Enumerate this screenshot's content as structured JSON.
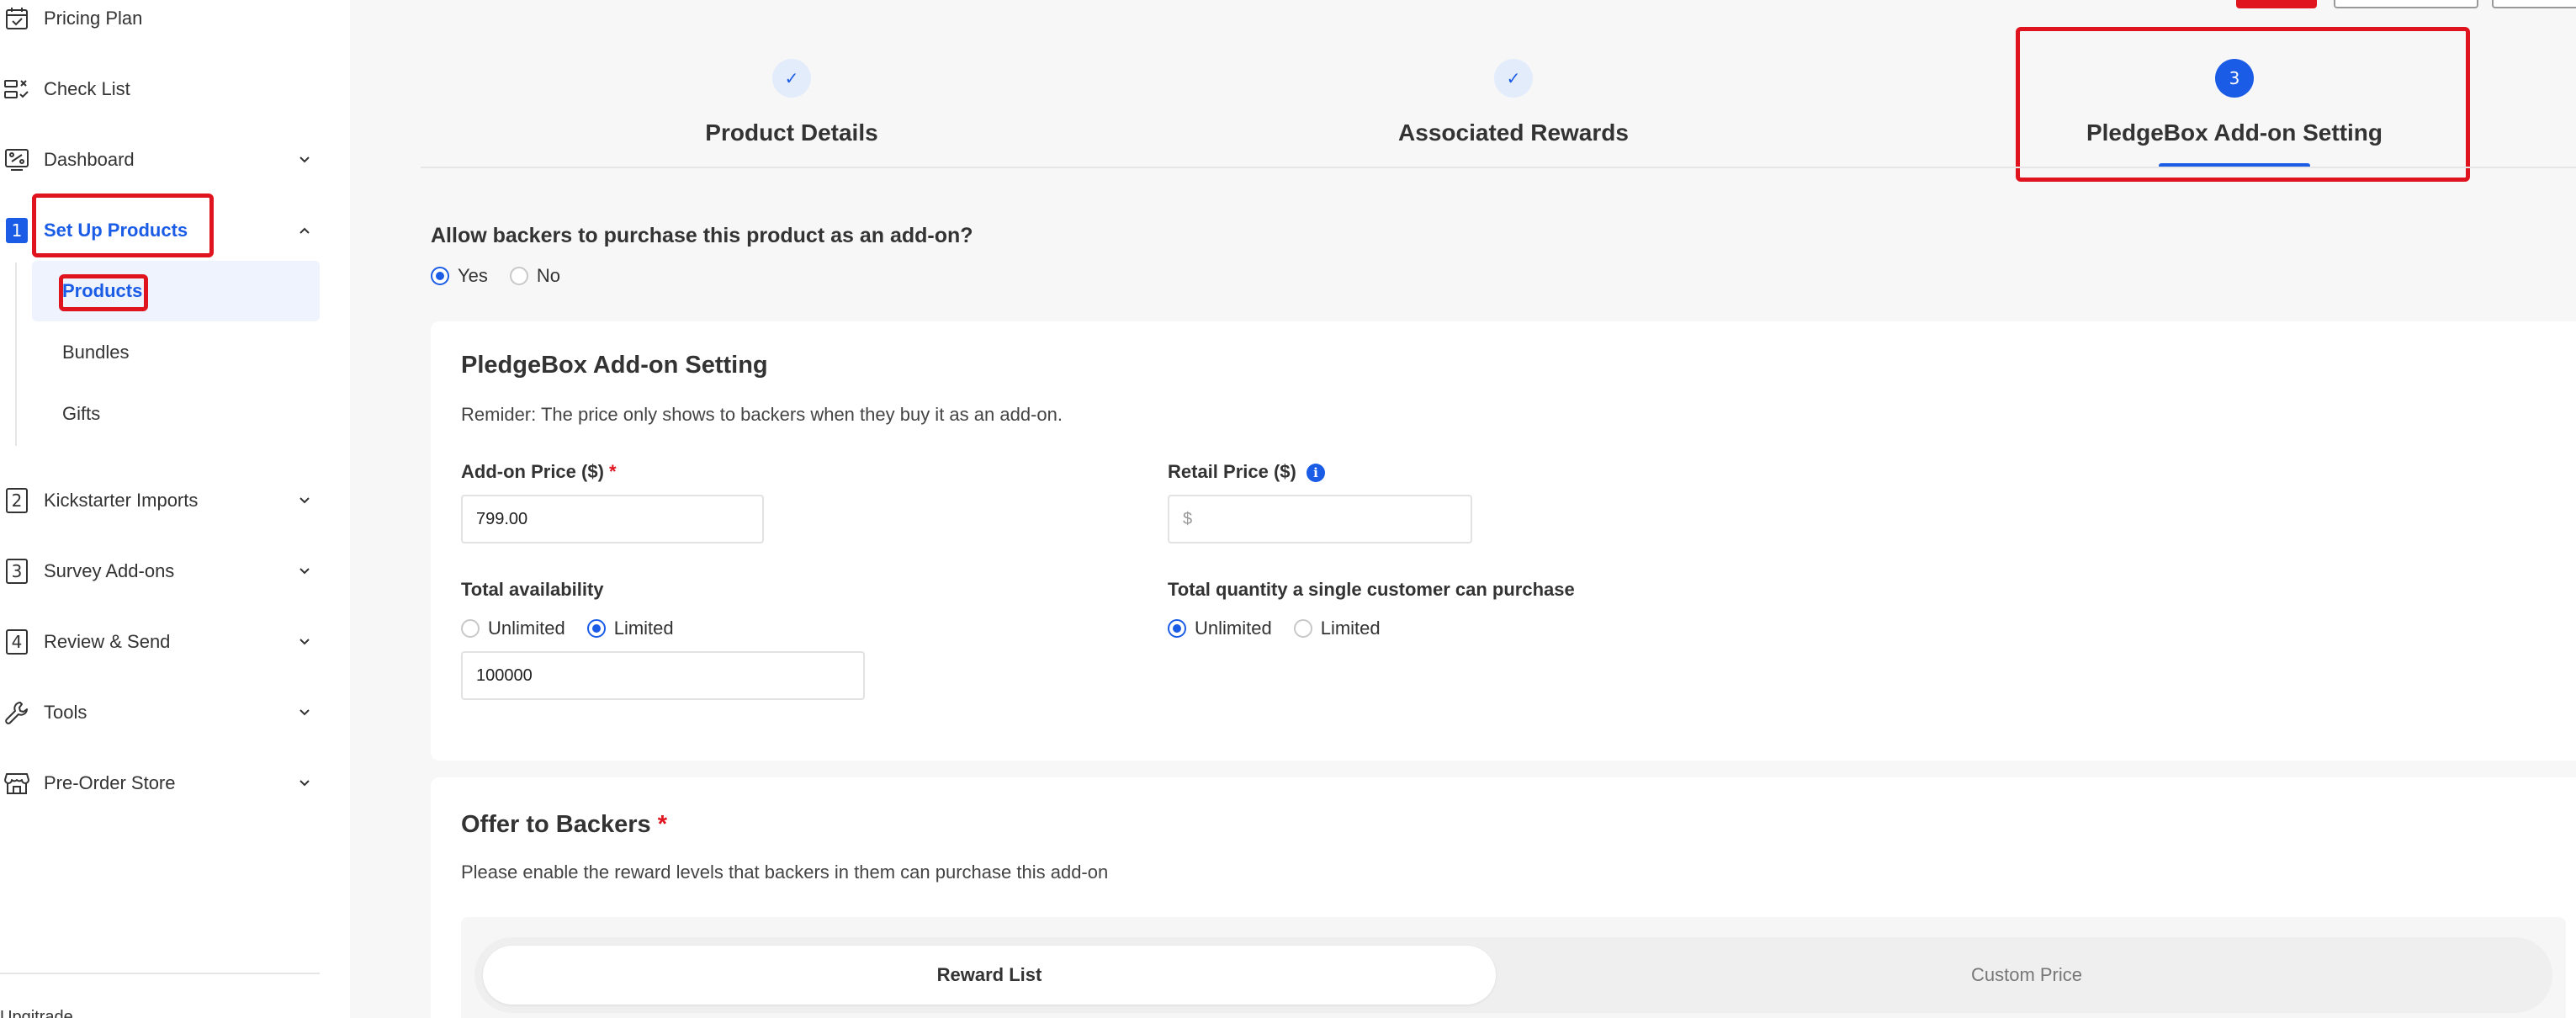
{
  "sidebar": {
    "items": [
      {
        "label": "Pricing Plan",
        "icon": "calendar-check-icon"
      },
      {
        "label": "Check List",
        "icon": "checklist-icon"
      },
      {
        "label": "Dashboard",
        "icon": "dashboard-icon"
      },
      {
        "label": "Set Up Products",
        "number": "1"
      },
      {
        "label": "Kickstarter Imports",
        "number": "2"
      },
      {
        "label": "Survey Add-ons",
        "number": "3"
      },
      {
        "label": "Review & Send",
        "number": "4"
      },
      {
        "label": "Tools",
        "icon": "wrench-icon"
      },
      {
        "label": "Pre-Order Store",
        "icon": "store-icon"
      }
    ],
    "sub_items": [
      {
        "label": "Products"
      },
      {
        "label": "Bundles"
      },
      {
        "label": "Gifts"
      }
    ],
    "bottom_text": "Upgitrade..."
  },
  "stepper": {
    "steps": [
      {
        "label": "Product Details",
        "state": "done",
        "symbol": "✓"
      },
      {
        "label": "Associated Rewards",
        "state": "done",
        "symbol": "✓"
      },
      {
        "label": "PledgeBox Add-on Setting",
        "state": "current",
        "symbol": "3"
      }
    ]
  },
  "addon_question": {
    "text": "Allow backers to purchase this product as an add-on?",
    "options": [
      "Yes",
      "No"
    ],
    "selected": "Yes"
  },
  "addon_card": {
    "title": "PledgeBox Add-on Setting",
    "reminder": "Remider: The price only shows to backers when they buy it as an add-on.",
    "addon_price_label": "Add-on Price ($)",
    "addon_price_required": "*",
    "addon_price_value": "799.00",
    "retail_price_label": "Retail Price ($)",
    "retail_price_placeholder": "$",
    "info_symbol": "i",
    "availability_label": "Total availability",
    "availability_options": [
      "Unlimited",
      "Limited"
    ],
    "availability_selected": "Limited",
    "availability_value": "100000",
    "quantity_label": "Total quantity a single customer can purchase",
    "quantity_options": [
      "Unlimited",
      "Limited"
    ],
    "quantity_selected": "Unlimited"
  },
  "offer_card": {
    "title": "Offer to Backers",
    "required": "*",
    "subtitle": "Please enable the reward levels that backers in them can purchase this add-on",
    "tabs": [
      "Reward List",
      "Custom Price"
    ],
    "active_tab": "Reward List"
  },
  "colors": {
    "accent": "#1a5ce6",
    "highlight": "#e0141e"
  }
}
